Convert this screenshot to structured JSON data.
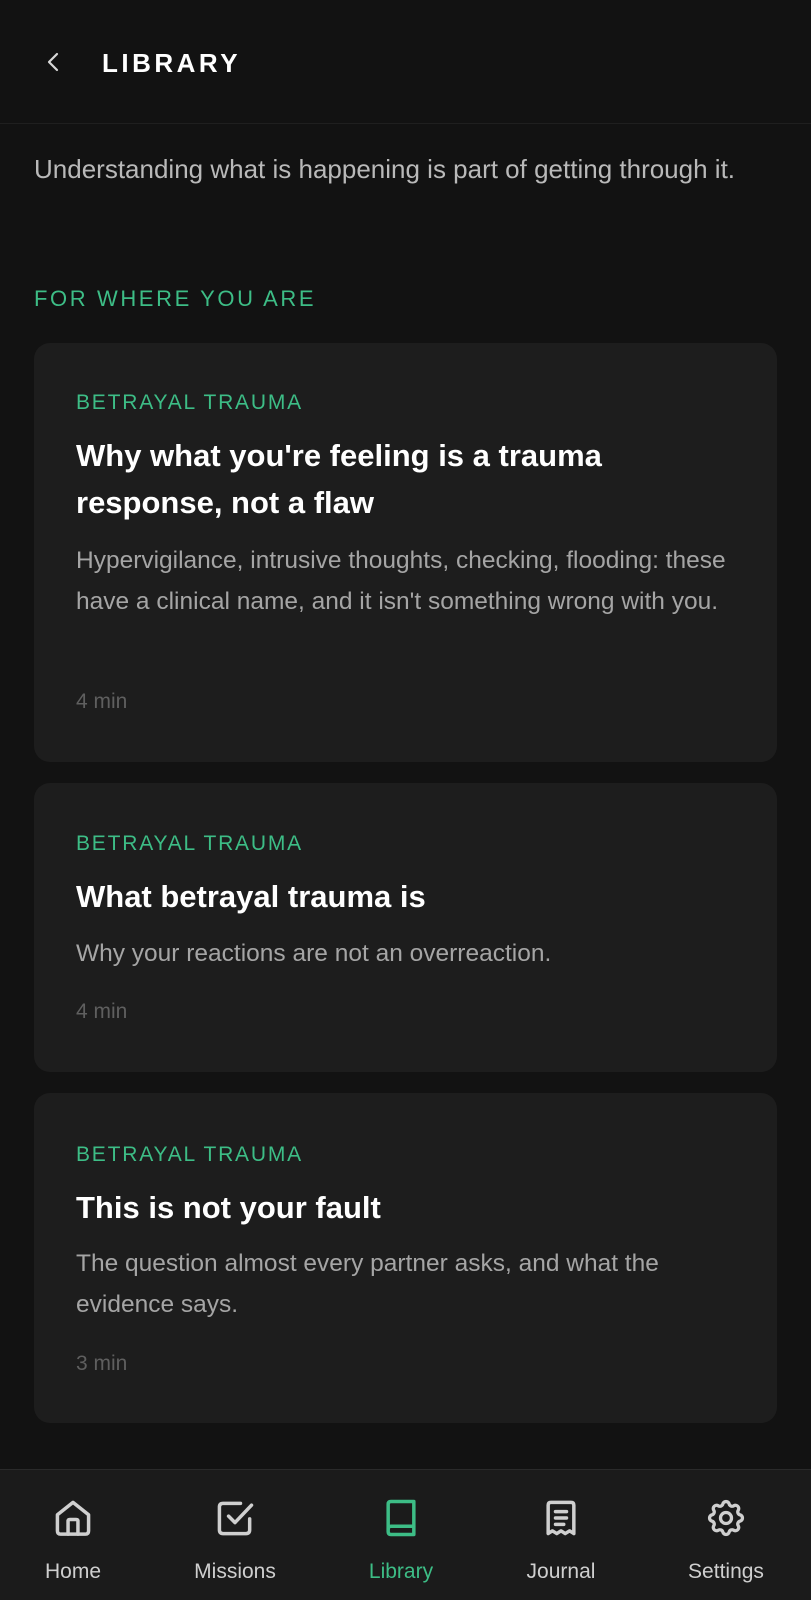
{
  "header": {
    "back_label": "Back",
    "title": "LIBRARY"
  },
  "intro": "Understanding what is happening is part of getting through it.",
  "section": {
    "label": "FOR WHERE YOU ARE"
  },
  "articles": [
    {
      "category": "BETRAYAL TRAUMA",
      "title": "Why what you're feeling is a trauma response, not a flaw",
      "description": "Hypervigilance, intrusive thoughts, checking, flooding: these have a clinical name, and it isn't something wrong with you.",
      "duration": "4 min"
    },
    {
      "category": "BETRAYAL TRAUMA",
      "title": "What betrayal trauma is",
      "description": "Why your reactions are not an overreaction.",
      "duration": "4 min"
    },
    {
      "category": "BETRAYAL TRAUMA",
      "title": "This is not your fault",
      "description": "The question almost every partner asks, and what the evidence says.",
      "duration": "3 min"
    }
  ],
  "nav": {
    "items": [
      {
        "label": "Home",
        "icon": "home-icon"
      },
      {
        "label": "Missions",
        "icon": "checkbox-icon"
      },
      {
        "label": "Library",
        "icon": "book-icon",
        "active": true
      },
      {
        "label": "Journal",
        "icon": "notepad-icon"
      },
      {
        "label": "Settings",
        "icon": "gear-icon"
      }
    ]
  },
  "colors": {
    "background": "#121212",
    "card": "#1d1d1d",
    "accent": "#3dbd86",
    "nav_background": "#1b1b1b"
  }
}
